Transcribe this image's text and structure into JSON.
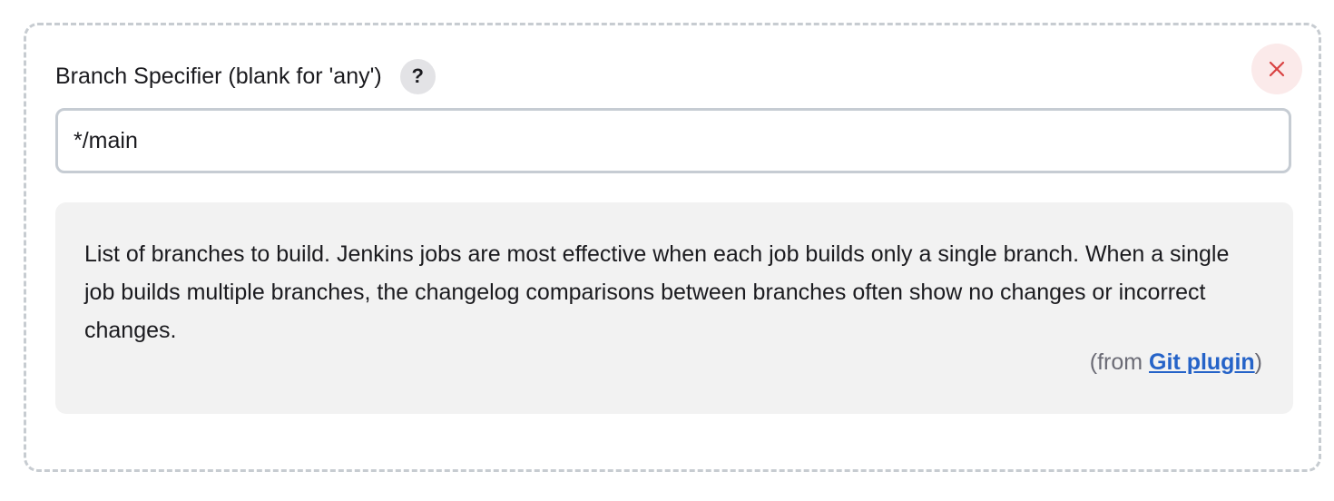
{
  "field": {
    "label": "Branch Specifier (blank for 'any')",
    "help_button_label": "?",
    "value": "*/main"
  },
  "delete_button": {
    "icon": "close-icon",
    "color": "#d94141"
  },
  "help": {
    "text": "List of branches to build. Jenkins jobs are most effective when each job builds only a single branch. When a single job builds multiple branches, the changelog comparisons between branches often show no changes or incorrect changes.",
    "source_prefix": "(from ",
    "source_link": "Git plugin",
    "source_suffix": ")"
  },
  "colors": {
    "link": "#2563c8",
    "help_background": "#f2f2f2",
    "dashed_border": "#c7ccd1"
  }
}
